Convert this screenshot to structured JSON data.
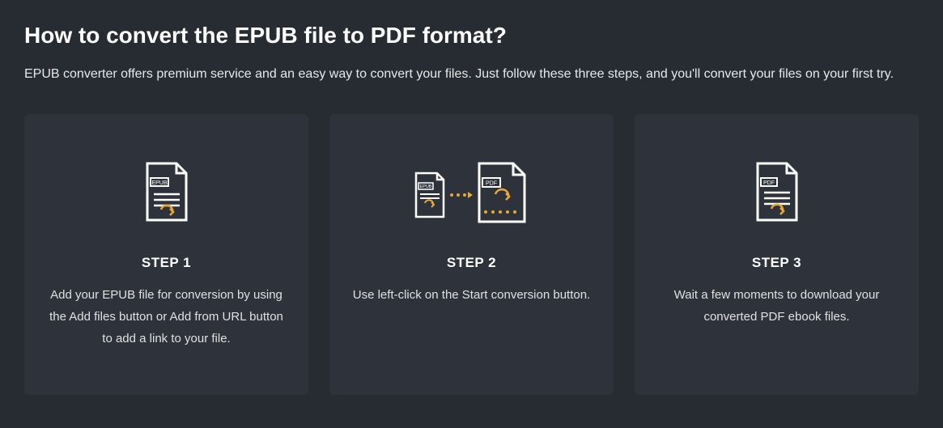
{
  "heading": "How to convert the EPUB file to PDF format?",
  "subheading": "EPUB converter offers premium service and an easy way to convert your files. Just follow these three steps, and you'll convert your files on your first try.",
  "steps": [
    {
      "title": "STEP 1",
      "description": "Add your EPUB file for conversion by using the Add files button or Add from URL button to add a link to your file."
    },
    {
      "title": "STEP 2",
      "description": "Use left-click on the Start conversion button."
    },
    {
      "title": "STEP 3",
      "description": "Wait a few moments to download your converted PDF ebook files."
    }
  ]
}
